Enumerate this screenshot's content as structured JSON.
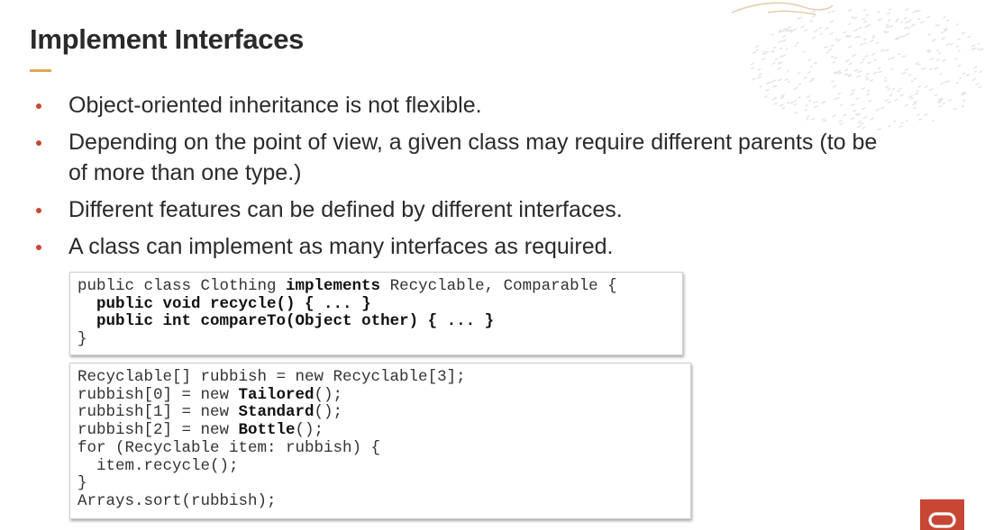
{
  "slide": {
    "title": "Implement Interfaces",
    "bullets": [
      "Object-oriented inheritance is not flexible.",
      "Depending on the point of view, a given class may require different parents (to be of more than one type.)",
      "Different features can be defined by different interfaces.",
      "A class can implement as many interfaces as required."
    ]
  },
  "code1": {
    "line1": {
      "a": "public class Clothing ",
      "b": "implements",
      "c": " Recyclable, Comparable {"
    },
    "line2": {
      "b": "public void recycle() { ... }"
    },
    "line3": {
      "b": "public int compareTo(Object other) { ... }"
    },
    "line4": {
      "a": "}"
    }
  },
  "code2": {
    "line1": {
      "a": "Recyclable[] rubbish = new Recyclable[3];"
    },
    "line2": {
      "a": "rubbish[0] = new ",
      "b": "Tailored",
      "c": "();"
    },
    "line3": {
      "a": "rubbish[1] = new ",
      "b": "Standard",
      "c": "();"
    },
    "line4": {
      "a": "rubbish[2] = new ",
      "b": "Bottle",
      "c": "();"
    },
    "line5": {
      "a": "for (Recyclable item: rubbish) {"
    },
    "line6": {
      "a": "item.recycle();"
    },
    "line7": {
      "a": "}"
    },
    "line8": {
      "a": "Arrays.sort(rubbish);"
    }
  },
  "colors": {
    "accent_red": "#c74634",
    "accent_gold": "#e2a85a",
    "text": "#2b2b2b"
  },
  "icons": {
    "brand_logo": "oracle-logo-icon",
    "decoration": "decorative-pattern-icon"
  }
}
